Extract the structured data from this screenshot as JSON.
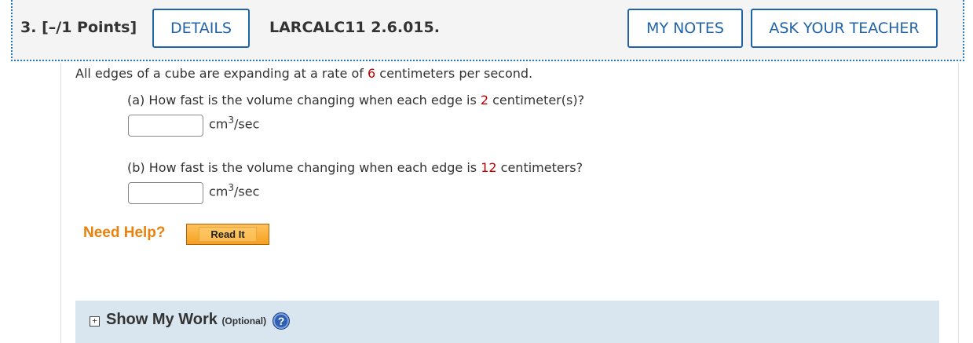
{
  "header": {
    "question_number": "3.",
    "points": "[–/1 Points]",
    "details_label": "DETAILS",
    "problem_code": "LARCALC11 2.6.015.",
    "my_notes_label": "MY NOTES",
    "ask_teacher_label": "ASK YOUR TEACHER"
  },
  "problem": {
    "intro_before": "All edges of a cube are expanding at a rate of ",
    "rate": "6",
    "intro_after": " centimeters per second.",
    "part_a": {
      "before": "(a) How fast is the volume changing when each edge is ",
      "value": "2",
      "after": " centimeter(s)?",
      "answer": "",
      "unit_base": "cm",
      "unit_exp": "3",
      "unit_rest": "/sec"
    },
    "part_b": {
      "before": "(b) How fast is the volume changing when each edge is ",
      "value": "12",
      "after": " centimeters?",
      "answer": "",
      "unit_base": "cm",
      "unit_exp": "3",
      "unit_rest": "/sec"
    }
  },
  "help": {
    "need_help": "Need Help?",
    "read_it": "Read It"
  },
  "show_work": {
    "toggle": "+",
    "label": "Show My Work",
    "optional": "(Optional)",
    "help_icon": "?"
  },
  "colors": {
    "accent": "#2163a8",
    "highlight": "#c00000",
    "need_help": "#e8820c",
    "show_work_bg": "#d9e6f0"
  }
}
